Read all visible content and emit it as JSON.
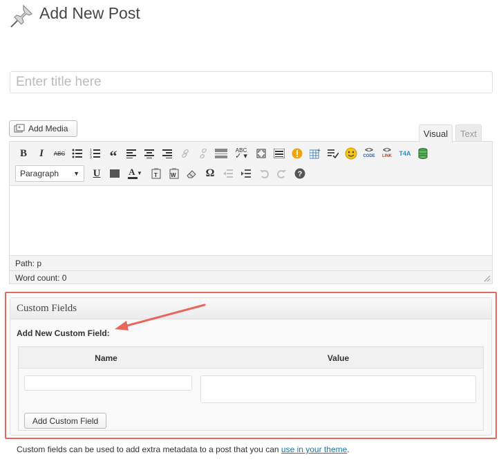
{
  "page": {
    "title": "Add New Post"
  },
  "title_field": {
    "placeholder": "Enter title here",
    "value": ""
  },
  "media": {
    "add_media_label": "Add Media"
  },
  "editor_tabs": {
    "visual": "Visual",
    "text": "Text"
  },
  "toolbar": {
    "row1": [
      "bold-icon",
      "italic-icon",
      "strikethrough-icon",
      "bullet-list-icon",
      "numbered-list-icon",
      "blockquote-icon",
      "align-left-icon",
      "align-center-icon",
      "align-right-icon",
      "link-icon",
      "unlink-icon",
      "more-tag-icon",
      "spellcheck-icon",
      "fullscreen-icon",
      "toolbar-toggle-icon",
      "warning-icon",
      "table-icon",
      "checklist-icon",
      "emoji-icon",
      "code-icon",
      "link-plugin-icon",
      "t4a-icon",
      "database-icon"
    ],
    "labels": {
      "bold": "B",
      "italic": "I",
      "strike": "ABC",
      "quote": "“",
      "spell": "ABC",
      "code": "CODE",
      "link": "LINK",
      "t4a": "T4A",
      "underline": "U",
      "text_color": "A",
      "omega": "Ω",
      "help": "?"
    },
    "format_select": "Paragraph",
    "row2": [
      "underline-icon",
      "justify-icon",
      "text-color-icon",
      "paste-text-icon",
      "paste-word-icon",
      "eraser-icon",
      "omega-icon",
      "outdent-icon",
      "indent-icon",
      "undo-icon",
      "redo-icon",
      "help-icon"
    ]
  },
  "editor_status": {
    "path": "Path: p",
    "word_count": "Word count: 0"
  },
  "custom_fields": {
    "title": "Custom Fields",
    "subtitle": "Add New Custom Field:",
    "col_name": "Name",
    "col_value": "Value",
    "name_value": "",
    "value_value": "",
    "add_button": "Add Custom Field",
    "help_prefix": "Custom fields can be used to add extra metadata to a post that you can ",
    "help_link": "use in your theme",
    "help_suffix": "."
  },
  "colors": {
    "highlight": "#e8675b",
    "link": "#21759b",
    "warning": "#f0a30a",
    "emoji": "#f5c518"
  }
}
